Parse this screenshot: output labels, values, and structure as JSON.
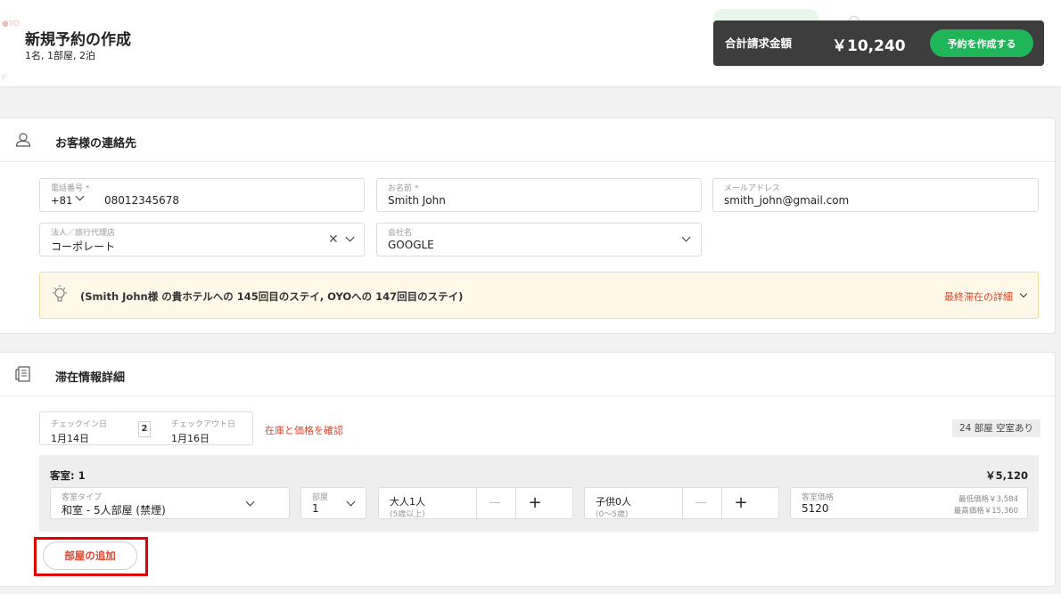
{
  "header": {
    "title": "新規予約の作成",
    "subtitle": "1名, 1部屋, 2泊"
  },
  "summary": {
    "label": "合計請求金額",
    "amount": "￥10,240",
    "create_button": "予約を作成する"
  },
  "contact": {
    "section_title": "お客様の連絡先",
    "phone": {
      "label": "電話番号 *",
      "country_code": "+81",
      "value": "08012345678"
    },
    "name": {
      "label": "お名前 *",
      "value": "Smith John"
    },
    "email": {
      "label": "メールアドレス",
      "value": "smith_john@gmail.com"
    },
    "agency": {
      "label": "法人／旅行代理店",
      "value": "コーポレート"
    },
    "company": {
      "label": "会社名",
      "value": "GOOGLE"
    },
    "banner_text": "(Smith John様 の貴ホテルへの 145回目のステイ, OYOへの 147回目のステイ)",
    "banner_link": "最終滞在の詳細"
  },
  "stay": {
    "section_title": "滞在情報詳細",
    "checkin": {
      "label": "チェックイン日",
      "value": "1月14日"
    },
    "nights": "2",
    "checkout": {
      "label": "チェックアウト日",
      "value": "1月16日"
    },
    "check_link": "在庫と価格を確認",
    "availability": "24 部屋 空室あり",
    "room": {
      "title": "客室: 1",
      "price": "￥5,120",
      "type_label": "客室タイプ",
      "type_value": "和室 - 5人部屋 (禁煙)",
      "rooms_label": "部屋",
      "rooms_value": "1",
      "adults_label": "大人1人",
      "adults_sub": "(5歳以上)",
      "children_label": "子供0人",
      "children_sub": "(0〜5歳)",
      "minus": "—",
      "plus": "+",
      "rate_label": "客室価格",
      "rate_value": "5120",
      "min_price": "最低価格￥3,584",
      "max_price": "最高価格￥15,360"
    },
    "add_room_button": "部屋の追加"
  },
  "colors": {
    "accent_green": "#1fb65a",
    "link_red": "#e0442a",
    "highlight_red": "#e00000"
  }
}
